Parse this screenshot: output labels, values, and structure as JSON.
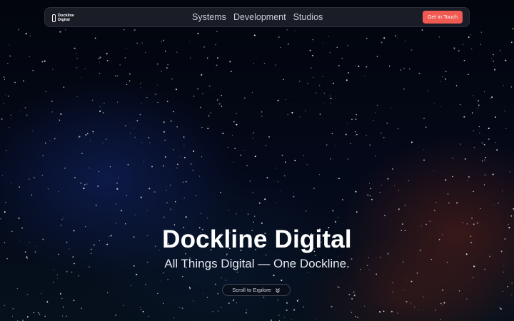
{
  "nav": {
    "logo_line1": "Dockline",
    "logo_line2": "Digital",
    "links": [
      "Systems",
      "Development",
      "Studios"
    ],
    "cta_label": "Get in Touch"
  },
  "hero": {
    "title": "Dockline Digital",
    "subtitle": "All Things Digital — One Dockline.",
    "scroll_label": "Scroll to Explore"
  },
  "icons": {
    "logo": "dockline-logo-icon",
    "scroll": "double-chevron-down-icon"
  },
  "colors": {
    "cta": "#f05a52",
    "background": "#03060f"
  }
}
